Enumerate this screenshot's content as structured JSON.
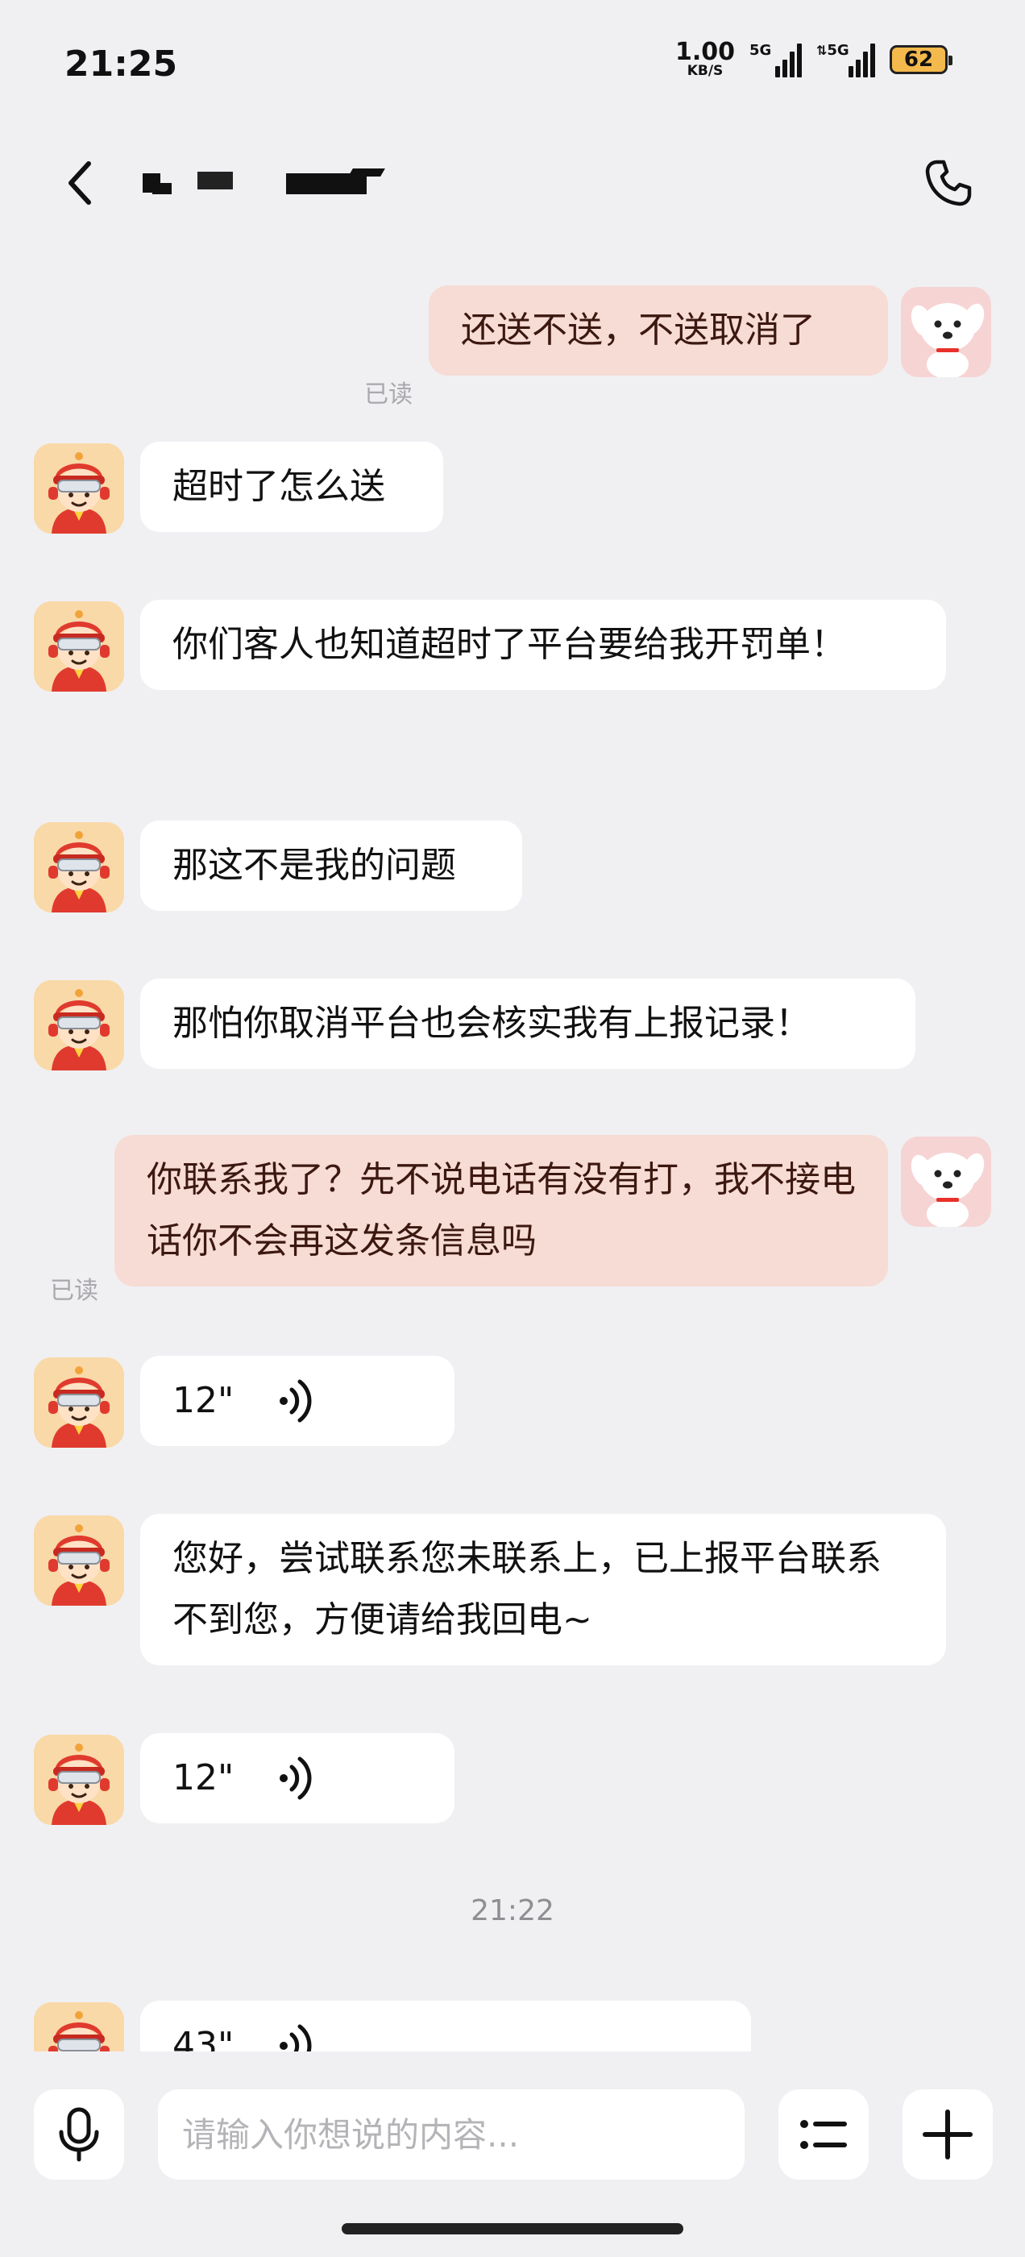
{
  "status_bar": {
    "time": "21:25",
    "net_speed_value": "1.00",
    "net_speed_unit": "KB/S",
    "signal1_label": "5G",
    "signal2_label": "5G",
    "battery": "62"
  },
  "header": {
    "title": "",
    "back_icon": "chevron-left-icon",
    "call_icon": "phone-icon"
  },
  "messages": [
    {
      "side": "out",
      "type": "text",
      "text": "还送不送，不送取消了",
      "read": "已读"
    },
    {
      "side": "in",
      "type": "text",
      "text": "超时了怎么送"
    },
    {
      "side": "in",
      "type": "text",
      "text": "你们客人也知道超时了平台要给我开罚单！"
    },
    {
      "side": "in",
      "type": "text",
      "text": "那这不是我的问题"
    },
    {
      "side": "in",
      "type": "text",
      "text": "那怕你取消平台也会核实我有上报记录！"
    },
    {
      "side": "out",
      "type": "text",
      "text": "你联系我了？先不说电话有没有打，我不接电话你不会再这发条信息吗",
      "read": "已读"
    },
    {
      "side": "in",
      "type": "voice",
      "duration": "12\""
    },
    {
      "side": "in",
      "type": "text",
      "text": "您好，尝试联系您未联系上，已上报平台联系不到您，方便请给我回电~"
    },
    {
      "side": "in",
      "type": "voice",
      "duration": "12\""
    },
    {
      "type": "timestamp",
      "text": "21:22"
    },
    {
      "side": "in",
      "type": "voice",
      "duration": "43\""
    }
  ],
  "input_bar": {
    "placeholder": "请输入你想说的内容...",
    "mic_icon": "microphone-icon",
    "menu_icon": "quick-reply-list-icon",
    "plus_icon": "plus-icon"
  },
  "colors": {
    "background": "#f0f0f3",
    "bubble_in": "#ffffff",
    "bubble_out": "#f6dcd5",
    "battery": "#f3b94d"
  }
}
